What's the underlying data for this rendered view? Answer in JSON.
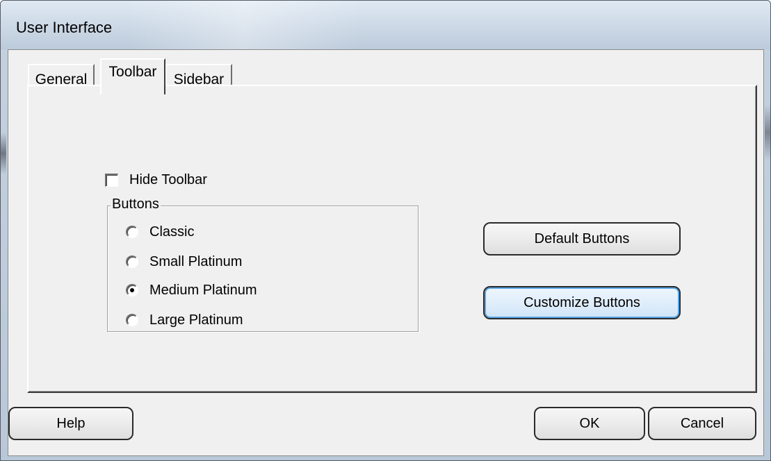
{
  "window": {
    "title": "User Interface"
  },
  "tabs": [
    {
      "label": "General",
      "active": false
    },
    {
      "label": "Toolbar",
      "active": true
    },
    {
      "label": "Sidebar",
      "active": false
    }
  ],
  "toolbar_tab": {
    "hide_toolbar": {
      "label": "Hide Toolbar",
      "checked": false
    },
    "buttons_group": {
      "label": "Buttons",
      "options": [
        {
          "label": "Classic",
          "selected": false
        },
        {
          "label": "Small Platinum",
          "selected": false
        },
        {
          "label": "Medium Platinum",
          "selected": true
        },
        {
          "label": "Large Platinum",
          "selected": false
        }
      ]
    },
    "default_buttons_label": "Default Buttons",
    "customize_buttons_label": "Customize Buttons"
  },
  "footer": {
    "help_label": "Help",
    "ok_label": "OK",
    "cancel_label": "Cancel"
  },
  "colors": {
    "dialog_background": "#f0f0f0",
    "focus_ring": "#5aa7e8",
    "title_bar": "#cfdbe8"
  }
}
